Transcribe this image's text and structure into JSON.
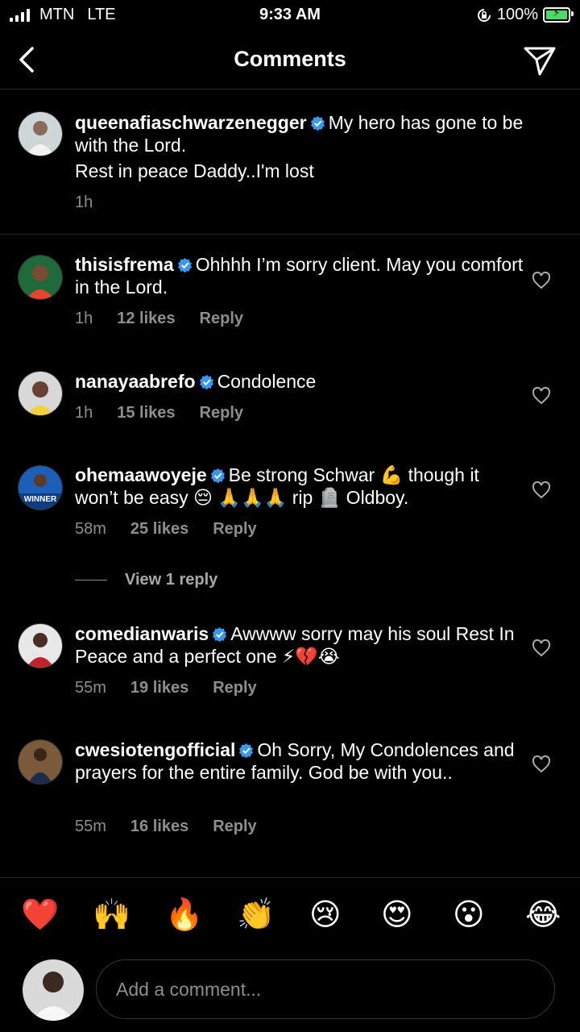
{
  "status_bar": {
    "carrier": "MTN",
    "network": "LTE",
    "time": "9:33 AM",
    "battery": "100%"
  },
  "header": {
    "title": "Comments"
  },
  "caption": {
    "username": "queenafiaschwarzenegger",
    "text": "My hero has gone to be with the Lord.",
    "text2": "Rest in peace Daddy..I'm lost",
    "time": "1h"
  },
  "comments": [
    {
      "username": "thisisfrema",
      "text": "Ohhhh I’m sorry client. May you comfort in the Lord.",
      "time": "1h",
      "likes": "12 likes",
      "reply": "Reply"
    },
    {
      "username": "nanayaabrefo",
      "text": "Condolence",
      "time": "1h",
      "likes": "15 likes",
      "reply": "Reply"
    },
    {
      "username": "ohemaawoyeje",
      "text": "Be strong Schwar 💪 though it won’t be easy 😔 🙏🙏🙏 rip 🪦 Oldboy.",
      "time": "58m",
      "likes": "25 likes",
      "reply": "Reply",
      "avatar_text": "WINNER"
    },
    {
      "username": "comedianwaris",
      "text": "Awwww sorry may his soul Rest In Peace and a perfect one ⚡💔😭",
      "time": "55m",
      "likes": "19 likes",
      "reply": "Reply"
    },
    {
      "username": "cwesiotengofficial",
      "text": "Oh Sorry, My Condolences and prayers for the entire family. God be with you..",
      "time": "55m",
      "likes": "16 likes",
      "reply": "Reply"
    }
  ],
  "view_replies": "View 1 reply",
  "quick_emojis": [
    "❤️",
    "🙌",
    "🔥",
    "👏",
    "😢",
    "😍",
    "😮",
    "😂"
  ],
  "input": {
    "placeholder": "Add a comment..."
  },
  "colors": {
    "background": "#000000",
    "secondary_text": "#8e8e8e",
    "verified": "#3897f0",
    "battery": "#4cd964"
  }
}
